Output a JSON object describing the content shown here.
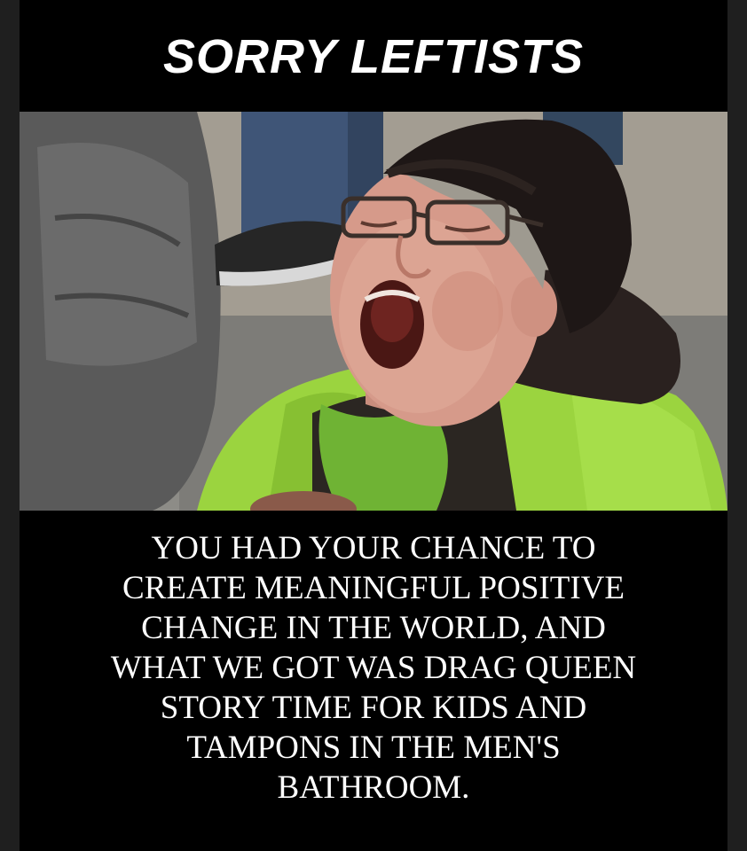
{
  "title": "SORRY LEFTISTS",
  "caption_lines": [
    "YOU HAD YOUR CHANCE TO",
    "CREATE MEANINGFUL POSITIVE",
    "CHANGE IN THE WORLD, AND",
    "WHAT WE GOT WAS DRAG QUEEN",
    "STORY TIME FOR KIDS AND",
    "TAMPONS IN THE MEN'S",
    "BATHROOM."
  ],
  "colors": {
    "background": "#000000",
    "text": "#ffffff",
    "jacket": "#9bd43f",
    "hat": "#1e1716"
  }
}
